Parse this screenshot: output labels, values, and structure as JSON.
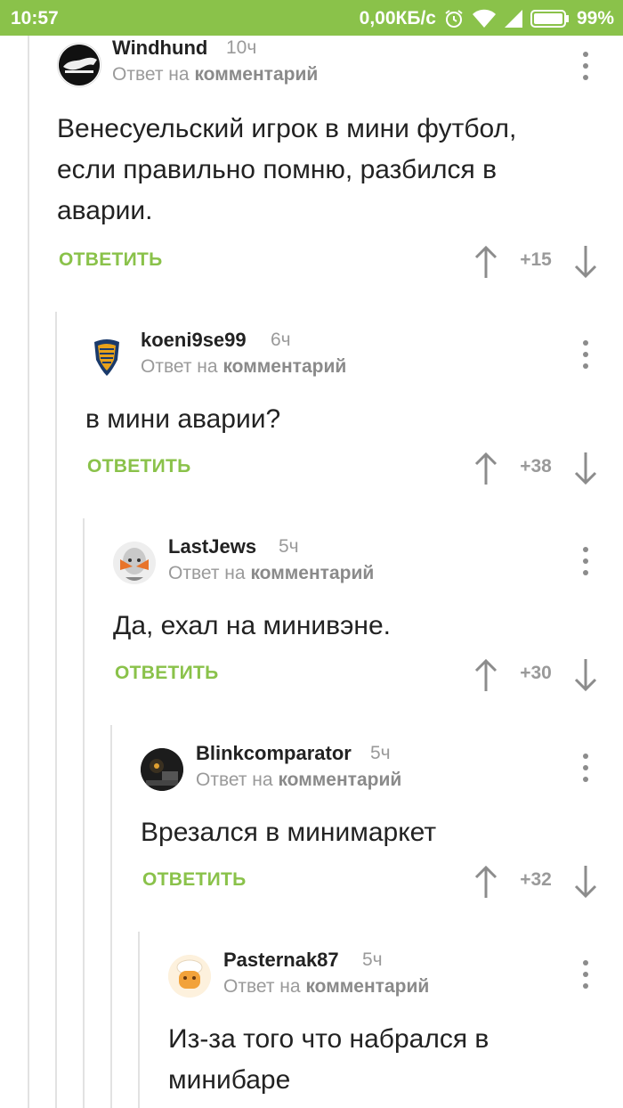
{
  "status_bar": {
    "time": "10:57",
    "network_speed": "0,00КБ/с",
    "battery": "99%",
    "icons": [
      "alarm-icon",
      "wifi-icon",
      "signal-icon",
      "battery-icon"
    ]
  },
  "colors": {
    "accent_green": "#8ac24a",
    "muted_gray": "#9a9a9a",
    "text": "#222222"
  },
  "comments": [
    {
      "author": "Windhund",
      "time": "10ч",
      "reply_prefix": "Ответ на",
      "reply_target": "комментарий",
      "text": "Венесуельский игрок в мини футбол, если правильно помню, разбился в аварии.",
      "reply_label": "ОТВЕТИТЬ",
      "score": "+15",
      "avatar": "dark-animal-logo"
    },
    {
      "author": "koeni9se99",
      "time": "6ч",
      "reply_prefix": "Ответ на",
      "reply_target": "комментарий",
      "text": "в мини аварии?",
      "reply_label": "ОТВЕТИТЬ",
      "score": "+38",
      "avatar": "koenigsegg-shield-logo"
    },
    {
      "author": "LastJews",
      "time": "5ч",
      "reply_prefix": "Ответ на",
      "reply_target": "комментарий",
      "text": "Да, ехал на минивэне.",
      "reply_label": "ОТВЕТИТЬ",
      "score": "+30",
      "avatar": "masked-character"
    },
    {
      "author": "Blinkcomparator",
      "time": "5ч",
      "reply_prefix": "Ответ на",
      "reply_target": "комментарий",
      "text": "Врезался в минимаркет",
      "reply_label": "ОТВЕТИТЬ",
      "score": "+32",
      "avatar": "dark-photo"
    },
    {
      "author": "Pasternak87",
      "time": "5ч",
      "reply_prefix": "Ответ на",
      "reply_target": "комментарий",
      "text": "Из-за того что набрался в минибаре",
      "avatar": "chef-character"
    }
  ]
}
